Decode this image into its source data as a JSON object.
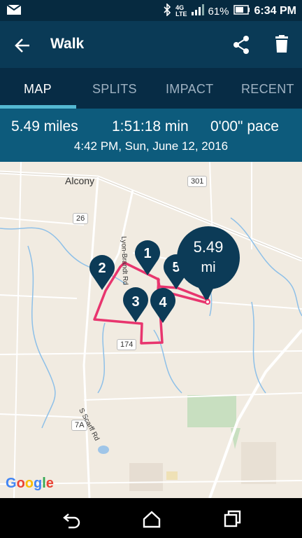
{
  "status_bar": {
    "battery_percent": "61%",
    "time": "6:34 PM",
    "network": "4G LTE"
  },
  "app_bar": {
    "title": "Walk"
  },
  "tabs": [
    {
      "label": "MAP"
    },
    {
      "label": "SPLITS"
    },
    {
      "label": "IMPACT"
    },
    {
      "label": "RECENT"
    }
  ],
  "summary": {
    "distance": "5.49 miles",
    "duration": "1:51:18 min",
    "pace": "0'00\" pace",
    "datetime": "4:42 PM, Sun, June 12, 2016"
  },
  "map": {
    "place_label": "Alcony",
    "road_labels": {
      "road_301": "301",
      "road_26": "26",
      "road_174": "174",
      "road_7a": "7A",
      "road_scarff": "S Scarff Rd",
      "road_brandt": "Lyon-Brandt Rd"
    },
    "markers": [
      "1",
      "2",
      "3",
      "4",
      "5"
    ],
    "distance_bubble": {
      "value": "5.49",
      "unit": "mi"
    },
    "route_color": "#e8356e",
    "marker_color": "#0c3b57",
    "google_logo": "Google"
  },
  "colors": {
    "status_bar": "#062a40",
    "app_bar": "#0a3a56",
    "tab_bar": "#072c45",
    "tab_indicator": "#54b8d2",
    "summary_bar": "#0d5b7c"
  }
}
